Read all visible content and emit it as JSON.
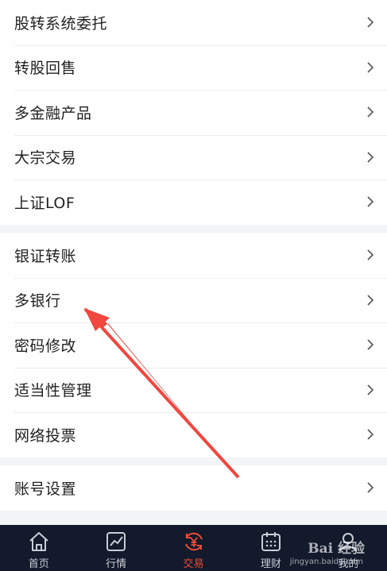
{
  "menu": {
    "group1": [
      "股转系统委托",
      "转股回售",
      "多金融产品",
      "大宗交易",
      "上证LOF"
    ],
    "group2": [
      "银证转账",
      "多银行",
      "密码修改",
      "适当性管理",
      "网络投票"
    ],
    "group3": [
      "账号设置"
    ]
  },
  "tabs": [
    {
      "label": "首页",
      "icon": "home-icon"
    },
    {
      "label": "行情",
      "icon": "chart-icon"
    },
    {
      "label": "交易",
      "icon": "trade-icon"
    },
    {
      "label": "理财",
      "icon": "calendar-icon"
    },
    {
      "label": "我的",
      "icon": "user-icon"
    }
  ],
  "active_tab": "交易",
  "watermark": {
    "brand": "Bai 经验",
    "url": "jingyan.baidu.com"
  },
  "colors": {
    "accent": "#f04a35",
    "tabbar_bg": "#121a2c",
    "annotation_arrow": "#f0473f"
  }
}
